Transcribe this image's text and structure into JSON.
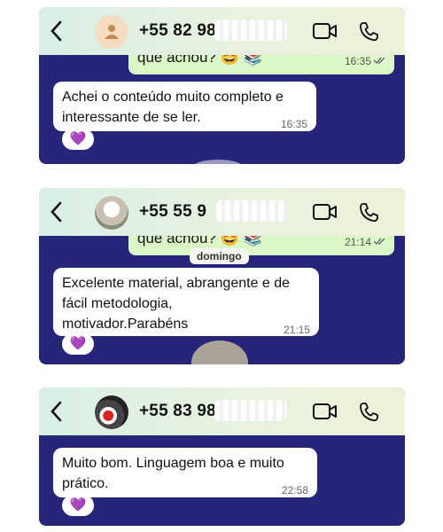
{
  "chats": [
    {
      "phone": "+55 82 98",
      "sent_preview": {
        "text": "que achou? 🤩 📚",
        "time": "16:35"
      },
      "day_label": "",
      "received": {
        "text": "Achei o conteúdo muito completo e\ninteressante de se ler.",
        "time": "16:35"
      },
      "reaction": "💜"
    },
    {
      "phone": "+55 55 9",
      "sent_preview": {
        "text": "que achou? 🤩 📚",
        "time": "21:14"
      },
      "day_label": "domingo",
      "received": {
        "text": "Excelente material, abrangente e de\nfácil metodologia,\nmotivador.Parabéns",
        "time": "21:15"
      },
      "reaction": "💜"
    },
    {
      "phone": "+55 83 98",
      "sent_preview": null,
      "day_label": "",
      "received": {
        "text": "Muito bom. Linguagem boa e muito\nprático.",
        "time": "22:58"
      },
      "reaction": "💜"
    }
  ],
  "icons": {
    "back": "chevron-left-icon",
    "video": "video-call-icon",
    "voice": "phone-call-icon",
    "avatar_default": "person-icon",
    "read_receipt": "double-check-icon"
  },
  "colors": {
    "header_bg": "#e3f1e0",
    "chat_bg": "#25267a",
    "sent_bubble": "#dcf8c6",
    "received_bubble": "#ffffff",
    "reaction": "#8d4be5"
  }
}
